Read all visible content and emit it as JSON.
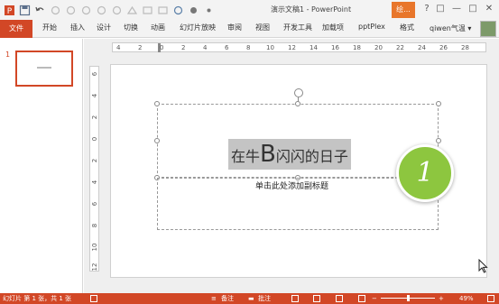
{
  "window": {
    "title": "演示文稿1 - PowerPoint",
    "context_tab": "绘...",
    "help": "?",
    "restore": "□",
    "minimize": "—",
    "maximize": "□",
    "close": "✕"
  },
  "ribbon": {
    "file": "文件",
    "tabs": [
      "开始",
      "插入",
      "设计",
      "切换",
      "动画",
      "幻灯片放映",
      "审阅",
      "视图",
      "开发工具",
      "加载项",
      "pptPlex",
      "格式"
    ],
    "user": "qiwen气温 ▾"
  },
  "ruler": {
    "horizontal": [
      "4",
      "2",
      "0",
      "2",
      "4",
      "6",
      "8",
      "10",
      "12",
      "14",
      "16",
      "18",
      "20",
      "22",
      "24",
      "26",
      "28"
    ],
    "vertical": [
      "6",
      "4",
      "2",
      "0",
      "2",
      "4",
      "6",
      "8",
      "10",
      "12"
    ]
  },
  "thumbnails": [
    {
      "number": "1"
    }
  ],
  "slide": {
    "title_prefix": "在牛",
    "title_big": "B",
    "title_suffix": "闪闪的日子",
    "subtitle": "单击此处添加副标题",
    "badge": "1"
  },
  "status": {
    "slide_info": "幻灯片 第 1 张，共 1 张",
    "notes": "备注",
    "comments": "批注",
    "zoom": "49%"
  },
  "colors": {
    "accent": "#d24726",
    "badge": "#8dc63f"
  },
  "icons": [
    "powerpoint-logo-icon",
    "save-icon",
    "undo-icon",
    "redo-icon",
    "shapes-icon",
    "spell-icon",
    "notes-icon",
    "comments-icon",
    "normal-view-icon",
    "slide-sorter-icon",
    "reading-view-icon",
    "slideshow-icon",
    "fit-icon",
    "cursor-icon"
  ]
}
